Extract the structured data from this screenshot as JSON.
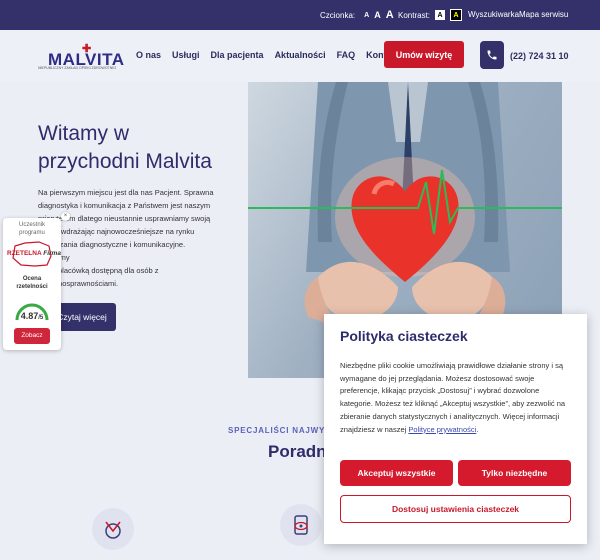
{
  "topbar": {
    "font_label": "Czcionka:",
    "font_sizes": [
      "A",
      "A",
      "A"
    ],
    "contrast_label": "Kontrast:",
    "contrast_options": [
      "A",
      "A"
    ],
    "search_link": "Wyszukiwarka",
    "sitemap_link": "Mapa serwisu"
  },
  "header": {
    "logo_name": "MALVITA",
    "logo_tagline": "NIEPUBLICZNY ZAKŁAD OPIEKI ZDROWOTNEJ",
    "nav": [
      "O nas",
      "Usługi",
      "Dla pacjenta",
      "Aktualności",
      "FAQ",
      "Kontakt"
    ],
    "appointment_button": "Umów wizytę",
    "phone": "(22) 724 31 10"
  },
  "hero": {
    "title_line1": "Witamy w",
    "title_line2": "przychodni Malvita",
    "lines": [
      "Na pierwszym miejscu jest dla nas Pacjent. Sprawna",
      "diagnostyka i komunikacja z Państwem jest naszym",
      "priorytetem dlatego nieustannie usprawniamy swoją",
      "pracę, wdrażając najnowocześniejsze na rynku",
      "rozwiązania diagnostyczne i komunikacyjne. Jesteśmy",
      "także placówką dostępną dla osób z",
      "niepełnosprawnościami."
    ],
    "more_button": "Czytaj więcej"
  },
  "badge": {
    "line1": "Uczestnik",
    "line2": "programu",
    "brand": "RZETELNA",
    "brand2": "Firma",
    "rating_label1": "Ocena",
    "rating_label2": "rzetelności",
    "score": "4.87",
    "score_suffix": "/5",
    "see_button": "Zobacz",
    "close": "×",
    "colors": {
      "gauge": "#3aa845",
      "button": "#d0263b"
    }
  },
  "section": {
    "kicker": "SPECJALIŚCI NAJWYŻSZ",
    "title": "Poradni"
  },
  "cookie": {
    "title": "Polityka ciasteczek",
    "text": "Niezbędne pliki cookie umożliwiają prawidłowe działanie strony i są wymagane do jej przeglądania. Możesz dostosować swoje preferencje, klikając przycisk „Dostosuj” i wybrać dozwolone kategorie. Możesz też kliknąć „Akceptuj wszystkie”, aby zezwolić na zbieranie danych statystycznych i analitycznych. Więcej informacji znajdziesz w naszej",
    "link": "Polityce prywatności",
    "link_suffix": ".",
    "accept_all": "Akceptuj wszystkie",
    "necessary_only": "Tylko niezbędne",
    "customize": "Dostosuj ustawienia ciasteczek"
  },
  "colors": {
    "brand_navy": "#33306a",
    "brand_red": "#c8182a",
    "heading": "#2f2c6b"
  }
}
